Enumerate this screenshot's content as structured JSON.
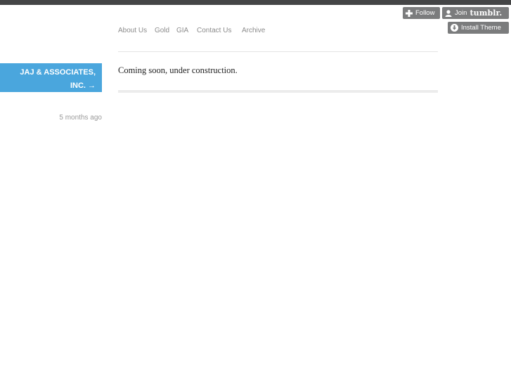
{
  "top_bar": {
    "follow_label": "Follow",
    "join_label": "Join",
    "join_brand": "tumblr.",
    "install_label": "Install Theme"
  },
  "nav": {
    "items": [
      "About Us",
      "Gold",
      "GIA",
      "Contact Us",
      "Archive"
    ]
  },
  "sidebar": {
    "blog_title_line1": "JAJ & ASSOCIATES,",
    "blog_title_line2": "INC. →",
    "post_time": "5 months ago"
  },
  "post": {
    "text": "Coming soon, under construction."
  },
  "colors": {
    "accent": "#4aa6dd",
    "topbar": "#444546",
    "button_bg": "#7b7c7d"
  },
  "icons": {
    "follow": "plus-icon",
    "join": "user-icon",
    "install": "download-icon"
  }
}
